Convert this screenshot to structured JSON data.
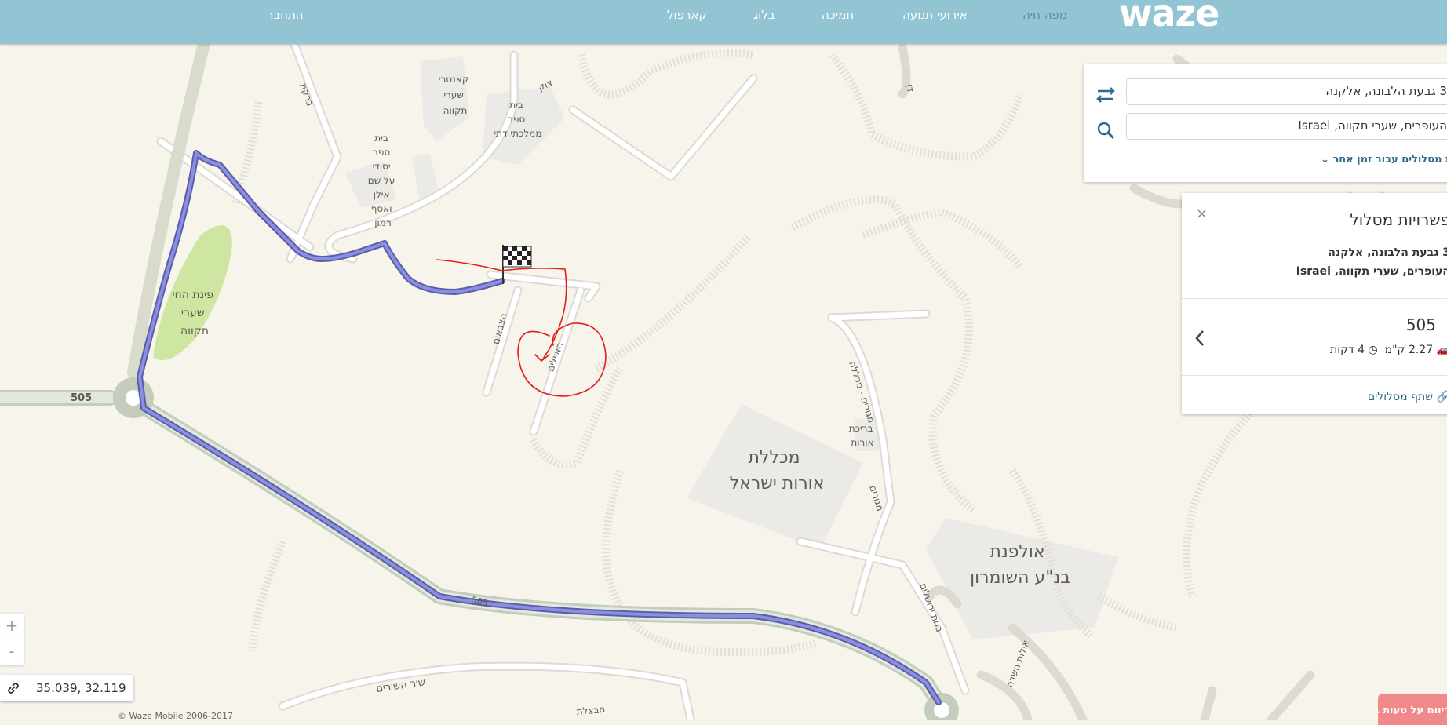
{
  "header": {
    "logo": "waze",
    "nav": [
      {
        "label": "מפה חיה"
      },
      {
        "label": "אירועי תנועה"
      },
      {
        "label": "תמיכה"
      },
      {
        "label": "בלוג"
      },
      {
        "label": "קארפול"
      }
    ],
    "connect": "התחבר"
  },
  "search": {
    "from": "3 גבעת הלבונה, אלקנה",
    "to": "העופרים, שערי תקווה, Israel",
    "later": "קת מסלולים עבור זמן אחר"
  },
  "routes_panel": {
    "title": "פשרויות מסלול",
    "close": "×",
    "from": "3 גבעת הלבונה, אלקנה",
    "to": "העופרים, שערי תקווה, Israel",
    "route_name": "505",
    "distance": "2.27 ק\"מ",
    "time": "4 דקות",
    "share": "שתף מסלולים"
  },
  "zoom": {
    "plus": "+",
    "minus": "-"
  },
  "coords": "35.039, 32.119",
  "copyright": "© Waze Mobile 2006-2017",
  "report_button": "דיווח על טעות במפה",
  "map_labels": {
    "road_505": "505",
    "road_505_b": "505",
    "park": [
      "פינת החי",
      "שערי",
      "תקווה"
    ],
    "country_club": [
      "קאנטרי",
      "שערי",
      "תקווה"
    ],
    "school1": [
      "בית",
      "ספר",
      "ממלכתי דתי"
    ],
    "school2": [
      "בית",
      "ספר",
      "יסודי",
      "על שם",
      "אילן",
      "ואסף",
      "רמון"
    ],
    "college": [
      "מכללת",
      "אורות ישראל"
    ],
    "ulpana": [
      "אולפנת",
      "בנ\"ע השומרון"
    ],
    "pool": [
      "בריכת",
      "אורות"
    ],
    "street_tzeviim": "הצבאים",
    "street_ayalim": "האיילים",
    "street_shir": "שיר השירים",
    "street_hatzvi": "צוק",
    "street_barkat": "ברקת",
    "street_college": "מגורים - מכללה",
    "street_dan": "דן",
    "street_bnot": "בנות ירושלים",
    "street_elot": "אילות השדה",
    "street_hatzel": "חבצלת",
    "street_hagefen": "מגורים"
  }
}
